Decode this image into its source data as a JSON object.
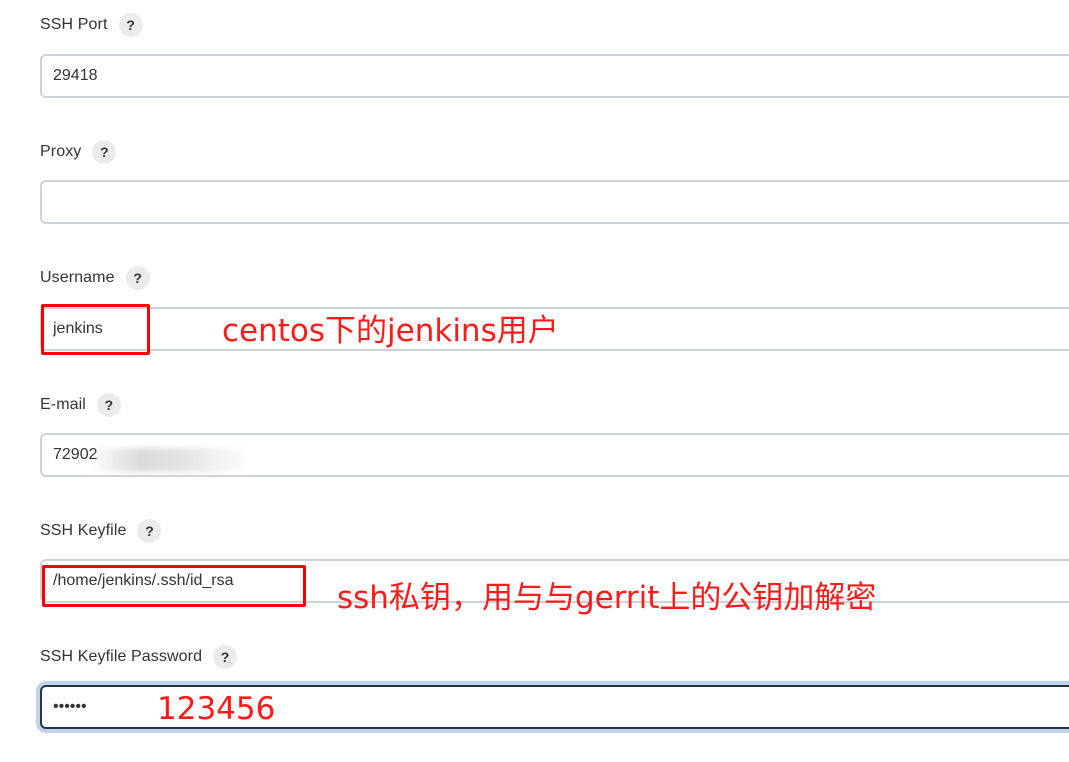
{
  "fields": {
    "ssh_port": {
      "label": "SSH Port",
      "help": "?",
      "value": "29418"
    },
    "proxy": {
      "label": "Proxy",
      "help": "?",
      "value": ""
    },
    "username": {
      "label": "Username",
      "help": "?",
      "value": "jenkins"
    },
    "email": {
      "label": "E-mail",
      "help": "?",
      "value": "72902"
    },
    "ssh_keyfile": {
      "label": "SSH Keyfile",
      "help": "?",
      "value": "/home/jenkins/.ssh/id_rsa"
    },
    "ssh_keyfile_password": {
      "label": "SSH Keyfile Password",
      "help": "?",
      "value": "••••••"
    }
  },
  "annotations": {
    "username_note": "centos下的jenkins用户",
    "keyfile_note": "ssh私钥，用与与gerrit上的公钥加解密",
    "password_note": "123456"
  },
  "colors": {
    "annotation_red": "#ff0000",
    "input_border": "#cfd3d7",
    "focus_ring": "#bcd4ec"
  }
}
